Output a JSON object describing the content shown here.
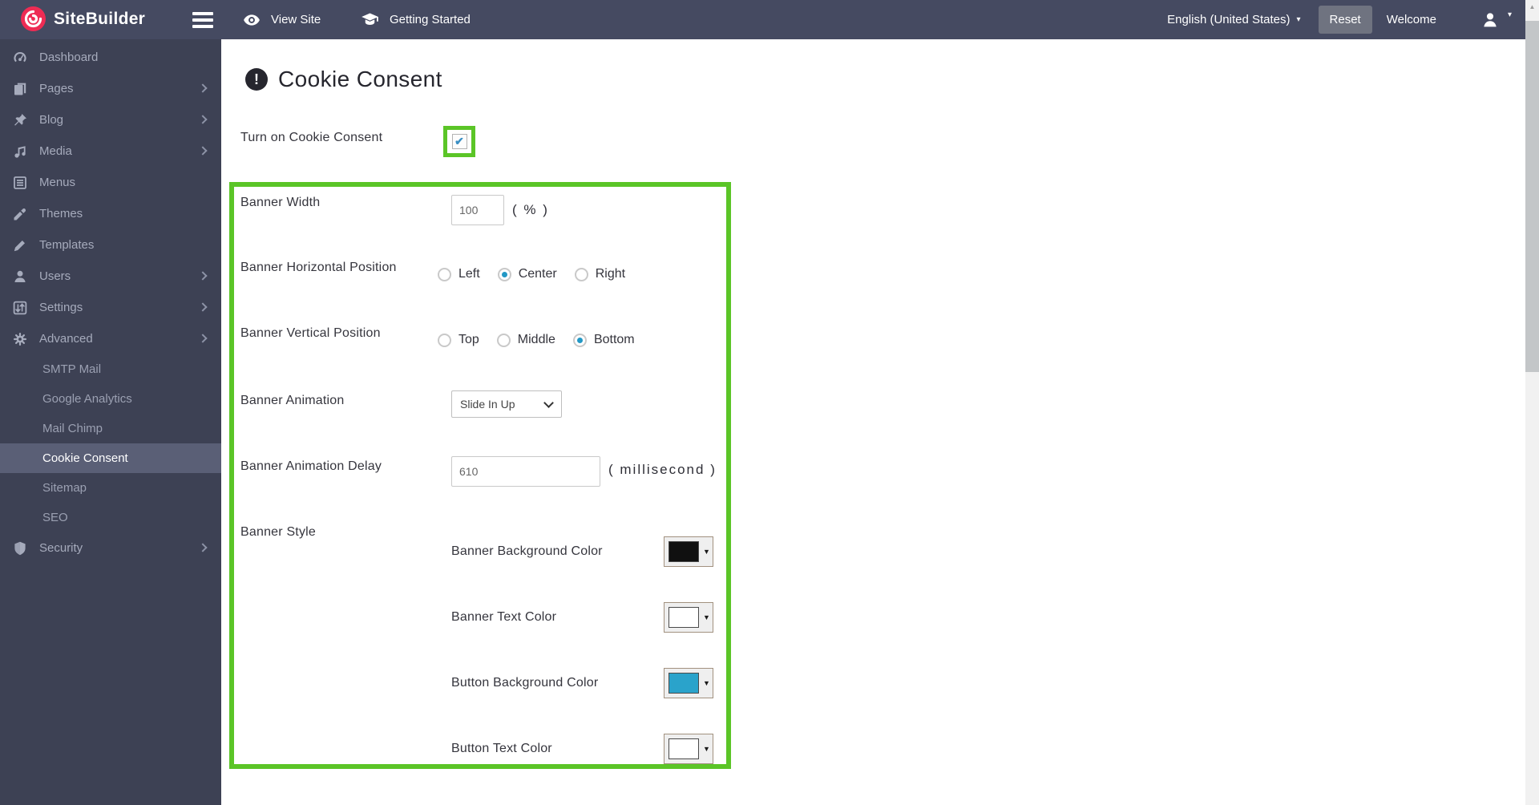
{
  "topbar": {
    "brand": "SiteBuilder",
    "view_site": "View Site",
    "getting_started": "Getting Started",
    "language": "English (United States)",
    "reset": "Reset",
    "welcome": "Welcome"
  },
  "sidebar": {
    "items": [
      {
        "label": "Dashboard",
        "has_submenu": false
      },
      {
        "label": "Pages",
        "has_submenu": true
      },
      {
        "label": "Blog",
        "has_submenu": true
      },
      {
        "label": "Media",
        "has_submenu": true
      },
      {
        "label": "Menus",
        "has_submenu": false
      },
      {
        "label": "Themes",
        "has_submenu": false
      },
      {
        "label": "Templates",
        "has_submenu": false
      },
      {
        "label": "Users",
        "has_submenu": true
      },
      {
        "label": "Settings",
        "has_submenu": true
      },
      {
        "label": "Advanced",
        "has_submenu": true
      }
    ],
    "advanced_submenu": [
      {
        "label": "SMTP Mail",
        "active": false
      },
      {
        "label": "Google Analytics",
        "active": false
      },
      {
        "label": "Mail Chimp",
        "active": false
      },
      {
        "label": "Cookie Consent",
        "active": true
      },
      {
        "label": "Sitemap",
        "active": false
      },
      {
        "label": "SEO",
        "active": false
      }
    ],
    "security": {
      "label": "Security",
      "has_submenu": true
    }
  },
  "main": {
    "title": "Cookie Consent",
    "turn_on": {
      "label": "Turn on Cookie Consent",
      "checked": true,
      "checkmark": "✔"
    },
    "banner_width": {
      "label": "Banner Width",
      "value": "100",
      "unit": "( % )"
    },
    "horizontal_position": {
      "label": "Banner Horizontal Position",
      "options": [
        {
          "label": "Left",
          "selected": false
        },
        {
          "label": "Center",
          "selected": true
        },
        {
          "label": "Right",
          "selected": false
        }
      ]
    },
    "vertical_position": {
      "label": "Banner Vertical Position",
      "options": [
        {
          "label": "Top",
          "selected": false
        },
        {
          "label": "Middle",
          "selected": false
        },
        {
          "label": "Bottom",
          "selected": true
        }
      ]
    },
    "animation": {
      "label": "Banner Animation",
      "value": "Slide In Up"
    },
    "animation_delay": {
      "label": "Banner Animation Delay",
      "value": "610",
      "unit": "( millisecond )"
    },
    "style": {
      "label": "Banner Style",
      "colors": [
        {
          "label": "Banner Background Color",
          "value": "#101010"
        },
        {
          "label": "Banner Text Color",
          "value": "#ffffff"
        },
        {
          "label": "Button Background Color",
          "value": "#2aa3cb"
        },
        {
          "label": "Button Text Color",
          "value": "#ffffff"
        }
      ]
    }
  },
  "glyphs": {
    "caret_down": "▾",
    "swatch_caret": "▼",
    "scroll_up": "▲",
    "exclamation": "!"
  },
  "colors": {
    "brand_pink": "#ee2c54",
    "highlight_green": "#5bc527",
    "accent_blue": "#2398c5"
  }
}
